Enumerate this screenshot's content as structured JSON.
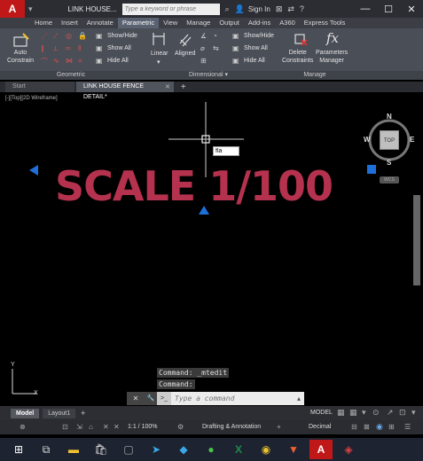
{
  "titlebar": {
    "app_letter": "A",
    "title": "LINK HOUSE...",
    "search_placeholder": "Type a keyword or phrase",
    "signin": "Sign In",
    "minimize": "—",
    "maximize": "☐",
    "close": "✕"
  },
  "ribbon": {
    "tabs": [
      "Home",
      "Insert",
      "Annotate",
      "Parametric",
      "View",
      "Manage",
      "Output",
      "Add-ins",
      "A360",
      "Express Tools"
    ],
    "active_tab": "Parametric",
    "auto_constrain": "Auto\nConstrain",
    "geo_show_hide": "Show/Hide",
    "geo_show_all": "Show All",
    "geo_hide_all": "Hide All",
    "linear": "Linear",
    "aligned": "Aligned",
    "dim_show_hide": "Show/Hide",
    "dim_show_all": "Show All",
    "dim_hide_all": "Hide All",
    "delete_constraints": "Delete\nConstraints",
    "parameters_manager": "Parameters\nManager",
    "panel_geometric": "Geometric",
    "panel_dimensional": "Dimensional ▾",
    "panel_manage": "Manage"
  },
  "filetabs": {
    "start": "Start",
    "active": "LINK HOUSE FENCE DETAIL*",
    "close": "✕",
    "add": "+"
  },
  "viewport": {
    "label": "[-][Top][2D Wireframe]"
  },
  "drawing": {
    "scale_text": "SCALE 1/100",
    "edit_box_value": "fla",
    "viewcube_top": "TOP",
    "compass_n": "N",
    "compass_s": "S",
    "compass_e": "E",
    "compass_w": "W",
    "wcs_label": "WCS",
    "ucs_y": "Y",
    "ucs_x": "X"
  },
  "command": {
    "history": [
      "Command: _mtedit",
      "Command:"
    ],
    "placeholder": "Type a command",
    "close_btn": "✕",
    "settings_btn": "🔧",
    "prompt_btn": ">_"
  },
  "layout_tabs": [
    "Model",
    "Layout1"
  ],
  "status": {
    "model": "MODEL",
    "scale": "1:1 / 100%",
    "workspace": "Drafting & Annotation",
    "units": "Decimal"
  },
  "colors": {
    "scale_text": "#b5324e",
    "grip": "#1e6fd8",
    "autocad_red": "#c01818"
  }
}
